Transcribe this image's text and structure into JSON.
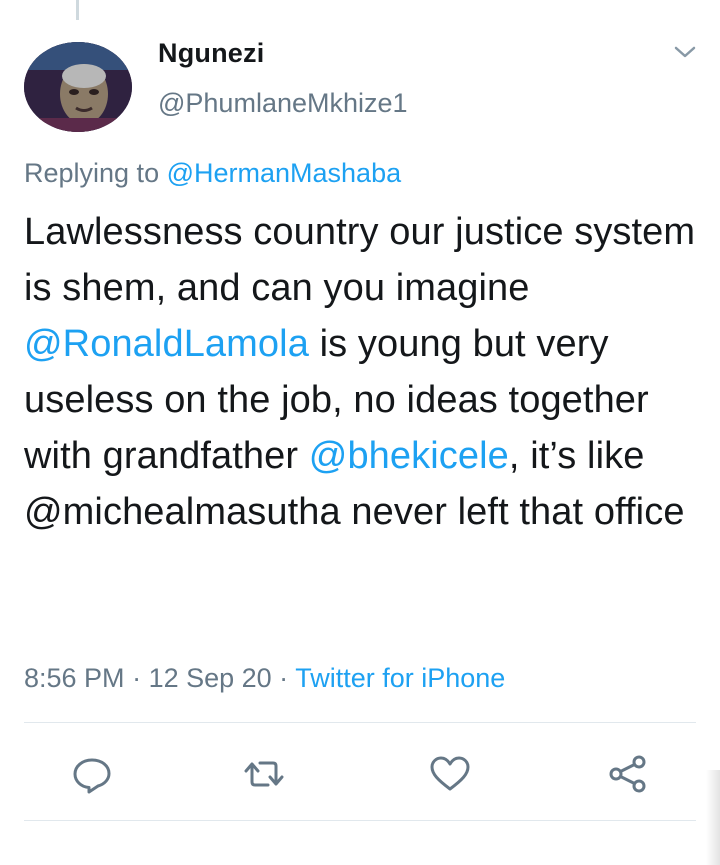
{
  "tweet": {
    "display_name": "Ngunezi",
    "handle": "@PhumlaneMkhize1",
    "replying_prefix": "Replying to ",
    "replying_to": "@HermanMashaba",
    "body": {
      "p1": "Lawlessness country our justice system is shem, and can you imagine ",
      "mention1": "@RonaldLamola",
      "p2": " is young but very useless on the job, no ideas together with grandfather ",
      "mention2": "@bhekicele",
      "p3": ", it’s like @michealmasutha never left that office"
    },
    "time": "8:56 PM",
    "separator": " · ",
    "date": "12 Sep 20",
    "source": "Twitter for iPhone"
  },
  "actions": {
    "reply_icon": "reply-icon",
    "retweet_icon": "retweet-icon",
    "like_icon": "heart-icon",
    "share_icon": "share-icon"
  },
  "colors": {
    "link": "#1da1f2",
    "text": "#14171a",
    "secondary": "#657786",
    "divider": "#e1e8ed"
  }
}
